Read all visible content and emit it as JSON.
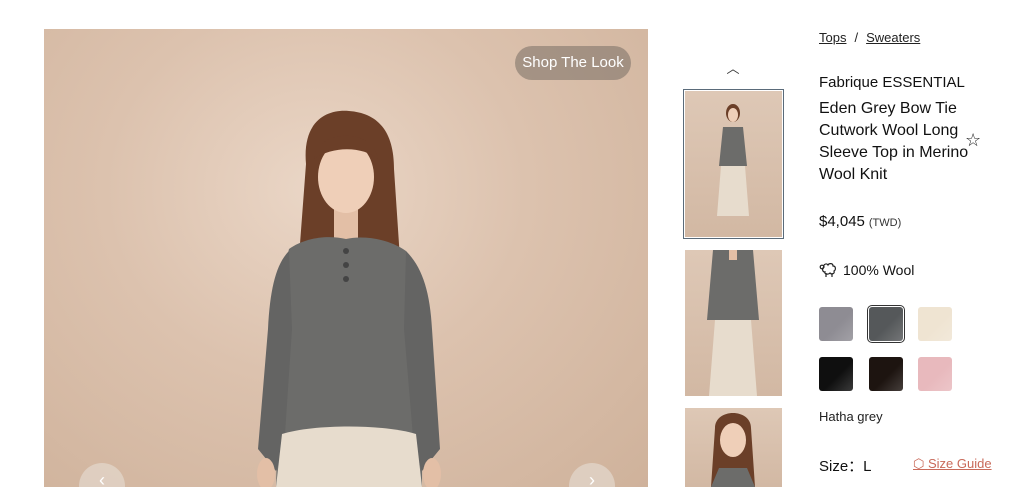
{
  "main_image": {
    "shop_the_look_label": "Shop The Look",
    "prev_icon": "chevron-left-icon",
    "next_icon": "chevron-right-icon",
    "prev_glyph": "‹",
    "next_glyph": "›"
  },
  "thumbnails": {
    "up_icon": "chevron-up-icon",
    "up_glyph": "︿",
    "selected_index": 0,
    "count_visible": 3
  },
  "breadcrumb": {
    "items": [
      "Tops",
      "Sweaters"
    ],
    "separator": "/"
  },
  "product": {
    "brand": "Fabrique ESSENTIAL",
    "title": "Eden Grey Bow Tie Cutwork Wool Long Sleeve Top in Merino Wool Knit",
    "favorite_glyph": "☆",
    "price": "$4,045",
    "currency": "(TWD)",
    "material": "100% Wool",
    "material_icon": "sheep-icon"
  },
  "swatches": {
    "colors": [
      "#8e8c93",
      "#55585a",
      "#efe4d2",
      "#0f0f0f",
      "#1d1410",
      "#e8b9bd"
    ],
    "selected_index": 1,
    "selected_name": "Hatha grey"
  },
  "size": {
    "label": "Size：L",
    "guide_label": "Size Guide",
    "guide_icon": "tag-icon",
    "guide_color": "#c96a5a"
  }
}
